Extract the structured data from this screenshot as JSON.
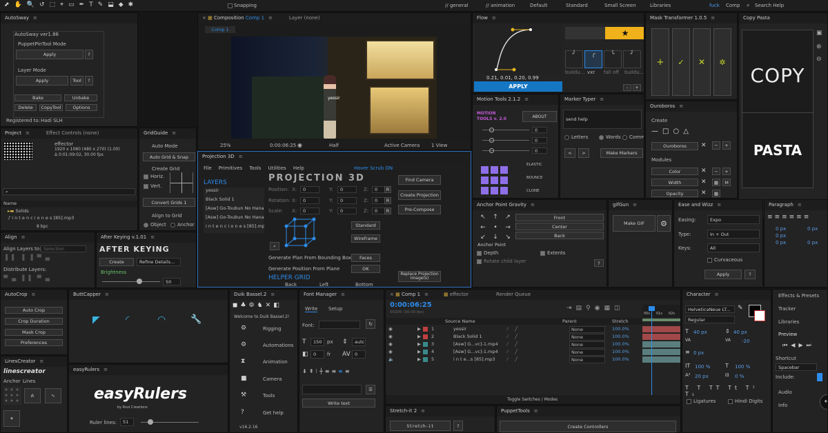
{
  "toolbar": {
    "tools": [
      "⬈",
      "✋",
      "🔍",
      "↺",
      "⬚",
      "⌖",
      "▭",
      "✒",
      "T",
      "✎",
      "⬓",
      "◆",
      "✱"
    ],
    "snapping": "Snapping",
    "workspaces": [
      "// general",
      "// animation",
      "Default",
      "Standard",
      "Small Screen",
      "Libraries",
      "fuck",
      "Comp"
    ],
    "search": "Search Help"
  },
  "autosway": {
    "title": "AutoSway",
    "version": "AutoSway ver1.86",
    "puppet_mode": "PuppetPinTool Mode",
    "apply1": "Apply",
    "q": "?",
    "layer_mode": "Layer Mode",
    "apply2": "Apply",
    "tool": "Tool",
    "bake": "Bake",
    "unbake": "Unbake",
    "delete": "Delete",
    "copytool": "CopyTool",
    "options": "Options",
    "registered": "Registered to:",
    "user": "Hadi SLH"
  },
  "project": {
    "title": "Project",
    "effect_controls": "Effect Controls (none)",
    "item": "effector",
    "dims": "1920 x 1080  (480 x 270) (1.00)",
    "duration": "Δ 0:01:09:02, 30.00 fps",
    "col_name": "Name",
    "rows": [
      "Solids",
      "i n t e n c i o n e s [85].mp3"
    ],
    "bpc": "8 bpc"
  },
  "gridguide": {
    "title": "GridGuide",
    "auto_mode": "Auto Mode",
    "auto_grid": "Auto Grid & Snap",
    "create_grid": "Create Grid",
    "horiz": "Horiz.",
    "vert": "Vert.",
    "convert": "Convert Grids 1",
    "align_grid": "Align to Grid",
    "object": "Object",
    "anchor": "Anchor P"
  },
  "comp": {
    "tab": "Composition",
    "name": "Comp 1",
    "layer_none": "Layer (none)",
    "subtab": "Comp 1",
    "caption": "yessir",
    "zoom": "25%",
    "time": "0:00:06:25",
    "res": "Half",
    "camera": "Active Camera",
    "view": "1 View"
  },
  "flow": {
    "title": "Flow",
    "values": "0.21, 0.01, 0.20, 0.99",
    "apply": "APPLY",
    "presets": [
      "buildu...",
      "vxr",
      "fall off",
      "buildu..."
    ],
    "minus": "-",
    "plus": "+"
  },
  "mask_transformer": {
    "title": "Mask Transformer 1.0.5"
  },
  "copy_pasta": {
    "title": "Copy Pasta",
    "copy": "COPY",
    "pasta": "PASTA"
  },
  "motion_tools": {
    "title": "Motion Tools 2.1.2",
    "logo1": "MOTION",
    "logo2": "TOOLS v. 2.0",
    "about": "ABOUT",
    "vals": [
      "0",
      "0",
      "0"
    ],
    "elastic": "ELASTIC",
    "bounce": "BOUNCE",
    "clone": "CLONE"
  },
  "marker_typer": {
    "title": "Marker Typer",
    "help": "send help",
    "letters": "Letters",
    "words": "Words",
    "commas": "Commas",
    "make": "Make Markers",
    "lt": "<",
    ">": ">",
    "gt": ">"
  },
  "ouroboros": {
    "title": "Ouroboros",
    "create": "Create",
    "name": "Ouroboros",
    "modules": "Modules",
    "color": "Color",
    "width": "Width",
    "opacity": "Opacity",
    "m": "M"
  },
  "align": {
    "title": "Align",
    "align_to": "Align Layers to:",
    "selection": "Selection",
    "distribute": "Distribute Layers:"
  },
  "after_keying": {
    "title": "After Keying v.1.01",
    "logo": "AFTER KEYING",
    "create": "Create",
    "refine": "Refine Details...",
    "brightness": "Brightness",
    "value": "50"
  },
  "projection": {
    "title": "Projection 3D",
    "menu": [
      "File",
      "Primitives",
      "Tools",
      "Utilities",
      "Help"
    ],
    "hover": "Hover Scrub ON",
    "logo": "PROJECTION 3D",
    "layers_h": "LAYERS",
    "layers": [
      "yessir",
      "Black Solid 1",
      "[Asw] Go-Toubun No Hana",
      "[Asw] Go-Toubun No Hana",
      "i n t e n c i o n e s [85].mp3"
    ],
    "position": "Position:",
    "rotation": "Rotation:",
    "scale": "Scale:",
    "x": "X:",
    "y": "Y:",
    "z": "Z:",
    "zero": "0",
    "r": "R",
    "standard": "Standard",
    "wireframe": "Wireframe",
    "gen_plan": "Generate Plan From Bounding Box",
    "faces": "Faces",
    "gen_pos": "Generate Position From Plane",
    "ok": "OK",
    "helper": "HELPER GRID",
    "back": "Back",
    "left": "Left",
    "bottom": "Bottom",
    "find_camera": "Find Camera",
    "create_proj": "Create Projection",
    "precompose": "Pre-Compose",
    "replace": "Replace Projection Image(s)"
  },
  "anchor_gravity": {
    "title": "Anchor Point Gravity",
    "front": "Front",
    "center": "Center",
    "back": "Back",
    "anchor": "Anchor Point",
    "depth": "Depth",
    "extents": "Extents",
    "rotate": "Rotate child layer",
    "q": "?"
  },
  "gifgun": {
    "title": "gifGun",
    "make": "Make GIF"
  },
  "ease_wizz": {
    "title": "Ease and Wizz",
    "easing_l": "Easing:",
    "easing": "Expo",
    "type_l": "Type:",
    "type": "In + Out",
    "keys_l": "Keys:",
    "keys": "All",
    "curvaceous": "Curvaceous",
    "apply": "Apply",
    "q": "?"
  },
  "paragraph": {
    "title": "Paragraph",
    "vals": [
      "0 px",
      "0 px",
      "0 px",
      "0 px",
      "0 px"
    ]
  },
  "autocrop": {
    "title": "AutoCrop",
    "buttons": [
      "Auto Crop",
      "Crop Duration",
      "Mask Crop",
      "Preferences"
    ]
  },
  "buttcapper": {
    "title": "ButtCapper"
  },
  "duik": {
    "title": "Duik Bassel.2",
    "welcome": "Welcome to Duik Bassel.2!",
    "items": [
      "Rigging",
      "Automations",
      "Animation",
      "Camera",
      "Tools",
      "Get help"
    ],
    "version": "v16.2.16"
  },
  "font_manager": {
    "title": "Font Manager",
    "write": "Write",
    "setup": "Setup",
    "font": "Font:",
    "size": "150",
    "px": "px",
    "auto": "autc",
    "zero1": "0",
    "fr": "fr",
    "zero2": "0",
    "write_text": "Write text"
  },
  "timeline": {
    "tab": "Comp 1",
    "effector": "effector",
    "render": "Render Queue",
    "time": "0:00:06:25",
    "fps": "00205 (30.00 fps)",
    "col_source": "Source Name",
    "col_parent": "Parent",
    "col_stretch": "Stretch",
    "layers": [
      {
        "n": "1",
        "name": "yessir",
        "parent": "None",
        "stretch": "100.0%",
        "color": "#c04040"
      },
      {
        "n": "2",
        "name": "Black Solid 1",
        "parent": "None",
        "stretch": "100.0%",
        "color": "#c04040"
      },
      {
        "n": "3",
        "name": "[Asw] G...vc]-1.mp4",
        "parent": "None",
        "stretch": "100.0%",
        "color": "#3a8a8a"
      },
      {
        "n": "4",
        "name": "[Asw] G...vc]-1.mp4",
        "parent": "None",
        "stretch": "100.0%",
        "color": "#3a8a8a"
      },
      {
        "n": "5",
        "name": "i n t e...s [85].mp3",
        "parent": "None",
        "stretch": "100.0%",
        "color": "#3a8a8a"
      }
    ],
    "toggle": "Toggle Switches / Modes",
    "ruler": [
      "00s",
      "01s",
      "02s"
    ]
  },
  "character": {
    "title": "Character",
    "font": "HelveticaNeue LT...",
    "style": "Regular",
    "size": "40 px",
    "leading": "40 px",
    "tracking": "-20",
    "kern": "",
    "h": "100 %",
    "v": "100 %",
    "b": "20 px",
    "t": "0 %",
    "px": "0 px",
    "ligatures": "Ligatures",
    "hindi": "Hindi Digits"
  },
  "effects": {
    "title": "Effects & Presets",
    "tracker": "Tracker",
    "libraries": "Libraries",
    "preview": "Preview",
    "shortcut": "Shortcut",
    "spacebar": "Spacebar",
    "include": "Include:",
    "audio": "Audio",
    "info": "Info"
  },
  "linescreator": {
    "title": "LinesCreator",
    "logo": "linescreator",
    "anchor": "Anchor",
    "lines": "Lines"
  },
  "easyrulers": {
    "title": "easyRulers",
    "logo": "easy",
    "logo2": "Rulers",
    "by": "by Rsul Creations",
    "lines": "Ruler lines:",
    "val": "51"
  },
  "stretch": {
    "title": "Stretch-it 2",
    "btn": "Stretch-it",
    "q": "?"
  },
  "puppettools": {
    "title": "PuppetTools",
    "create": "Create Controllers"
  }
}
